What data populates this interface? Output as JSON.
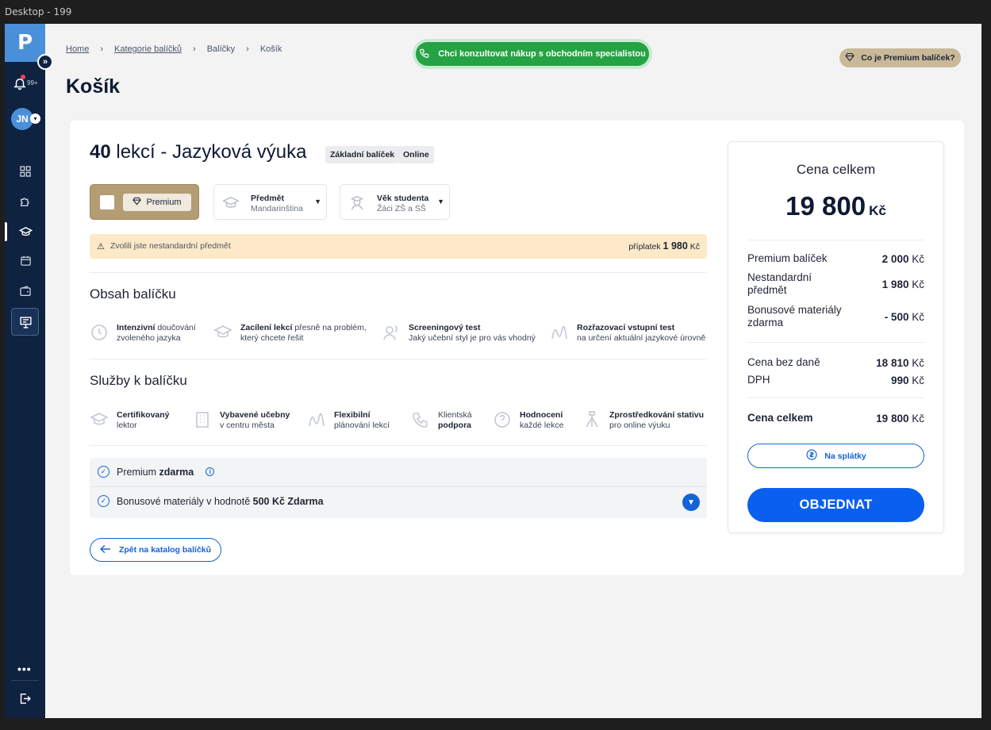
{
  "frame": {
    "title": "Desktop - 199"
  },
  "sidebar": {
    "logo": "P",
    "expand_icon": "»",
    "notifications": "99+",
    "avatar": "JN",
    "more": "•••"
  },
  "breadcrumb": {
    "home": "Home",
    "categories": "Kategorie balíčků",
    "packages": "Balíčky",
    "current": "Košík",
    "separator": "›"
  },
  "page_title": "Košík",
  "consult_button": "Chci konzultovat nákup s obchodním specialistou",
  "premium_question": "Co je Premium balíček?",
  "package": {
    "title_number": "40",
    "title_rest": " lekcí - Jazyková výuka",
    "tags": [
      "Základní balíček",
      "Online"
    ],
    "premium_label": "Premium",
    "subject_label": "Předmět",
    "subject_value": "Mandarinština",
    "age_label": "Věk studenta",
    "age_value": "Žáci ZŠ a SŠ"
  },
  "warning": {
    "text": "Zvolili jste nestandardní předmět",
    "surcharge_label": "příplatek",
    "surcharge_value": "1 980",
    "surcharge_currency": "Kč"
  },
  "content": {
    "title": "Obsah balíčku",
    "items": [
      {
        "bold": "Intenzivní",
        "rest": " doučování",
        "line2": "zvoleného jazyka"
      },
      {
        "bold": "Zacílení lekcí",
        "rest": " přesně na problém,",
        "line2": "který chcete řešit"
      },
      {
        "bold": "Screeningový test",
        "rest": "",
        "line2": "Jaký učební styl je pro vás vhodný"
      },
      {
        "bold": "Rozřazovací vstupní test",
        "rest": "",
        "line2": "na určení aktuální jazykové úrovně"
      }
    ]
  },
  "services": {
    "title": "Služby k balíčku",
    "items": [
      {
        "line1": "Certifikovaný",
        "line2": "lektor",
        "bold_line": 1
      },
      {
        "line1": "Vybavené učebny",
        "line2": "v centru města",
        "bold_line": 1
      },
      {
        "line1": "Flexibilní",
        "line2": "plánování lekcí",
        "bold_line": 1
      },
      {
        "line1": "Klientská",
        "line2": "podpora",
        "bold_line": 2
      },
      {
        "line1": "Hodnocení",
        "line2": "každé lekce",
        "bold_line": 1
      },
      {
        "line1": "Zprostředkování stativu",
        "line2": "pro online výuku",
        "bold_line": 1
      }
    ]
  },
  "benefits": [
    {
      "text": "Premium ",
      "bold": "zdarma"
    },
    {
      "text": "Bonusové materiály v hodnotě ",
      "bold": "500 Kč Zdarma"
    }
  ],
  "back_button": "Zpět na katalog balíčků",
  "summary": {
    "title": "Cena celkem",
    "total": "19 800",
    "currency": "Kč",
    "lines": [
      {
        "label": "Premium balíček",
        "value": "2 000",
        "cur": "Kč"
      },
      {
        "label": "Nestandardní předmět",
        "value": "1 980",
        "cur": "Kč"
      },
      {
        "label": "Bonusové materiály zdarma",
        "value": "- 500",
        "cur": "Kč"
      }
    ],
    "tax_lines": [
      {
        "label": "Cena bez daně",
        "value": "18 810",
        "cur": "Kč"
      },
      {
        "label": "DPH",
        "value": "990",
        "cur": "Kč"
      }
    ],
    "grand_label": "Cena celkem",
    "grand_value": "19 800",
    "grand_cur": "Kč",
    "split_button": "Na splátky",
    "order_button": "OBJEDNAT"
  },
  "colors": {
    "sidebar": "#0f2240",
    "primary": "#0a5ff0",
    "green": "#25a244",
    "gold": "#b49c73",
    "warning": "#fde9c8"
  }
}
